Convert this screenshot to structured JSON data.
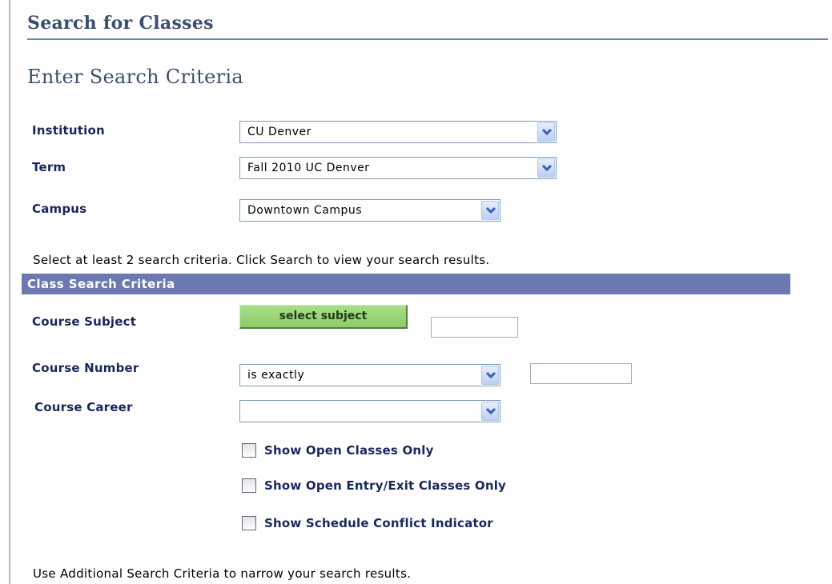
{
  "page": {
    "title": "Search for Classes",
    "section_title": "Enter Search Criteria"
  },
  "basic_criteria": {
    "institution": {
      "label": "Institution",
      "value": "CU Denver"
    },
    "term": {
      "label": "Term",
      "value": "Fall 2010 UC Denver"
    },
    "campus": {
      "label": "Campus",
      "value": "Downtown Campus"
    }
  },
  "instructions": {
    "select_criteria": "Select at least 2 search criteria. Click Search to view your search results.",
    "additional": "Use Additional Search Criteria to narrow your search results."
  },
  "class_search": {
    "title": "Class Search Criteria",
    "course_subject": {
      "label": "Course Subject",
      "button_label": "select subject",
      "value": ""
    },
    "course_number": {
      "label": "Course Number",
      "operator": "is exactly",
      "value": ""
    },
    "course_career": {
      "label": "Course Career",
      "value": ""
    },
    "checkboxes": [
      {
        "label": "Show Open Classes Only",
        "checked": false
      },
      {
        "label": "Show Open Entry/Exit Classes Only",
        "checked": false
      },
      {
        "label": "Show Schedule Conflict Indicator",
        "checked": false
      }
    ]
  },
  "colors": {
    "title_text": "#3c4f71",
    "label_text": "#17285a",
    "criteria_bar": "#6a79b0",
    "select_button_green": "#8ccc6a"
  },
  "icons": {
    "dropdown": "chevron-down-icon"
  }
}
